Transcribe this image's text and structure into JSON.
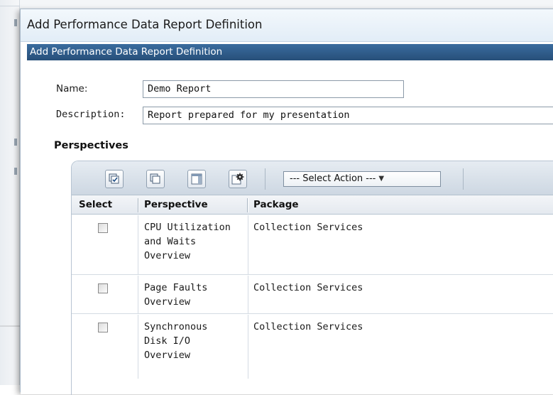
{
  "dialog": {
    "title": "Add Performance Data Report Definition",
    "subtitle": "Add Performance Data Report Definition"
  },
  "form": {
    "name_label": "Name:",
    "name_value": "Demo Report",
    "description_label": "Description:",
    "description_value": "Report prepared for my presentation"
  },
  "perspectives": {
    "heading": "Perspectives",
    "toolbar": {
      "select_all_icon": "select-all-icon",
      "deselect_all_icon": "deselect-all-icon",
      "columns_icon": "columns-icon",
      "settings_icon": "table-settings-icon",
      "select_action_label": "--- Select Action ---"
    },
    "columns": {
      "select": "Select",
      "perspective": "Perspective",
      "package": "Package"
    },
    "rows": [
      {
        "perspective": "CPU Utilization\nand Waits\nOverview",
        "package": "Collection Services"
      },
      {
        "perspective": "Page Faults\nOverview",
        "package": "Collection Services"
      },
      {
        "perspective": "Synchronous\nDisk I/O\nOverview",
        "package": "Collection Services"
      }
    ]
  },
  "colors": {
    "subtitle_bar": "#2c5a8a",
    "title_bar": "#e8f0f8"
  }
}
